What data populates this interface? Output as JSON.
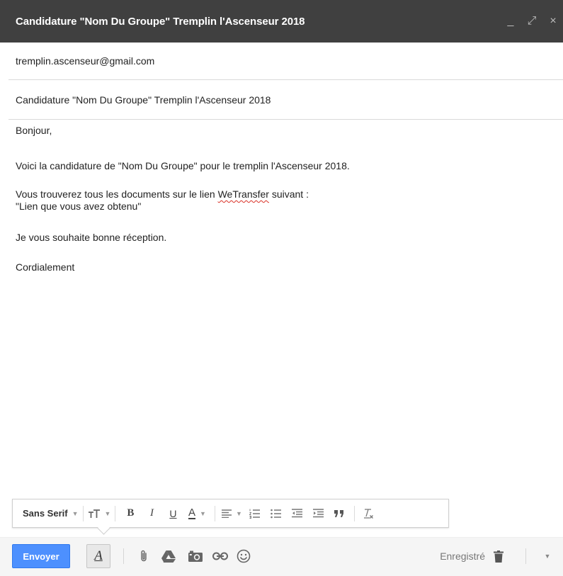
{
  "window": {
    "title": "Candidature \"Nom Du Groupe\" Tremplin l'Ascenseur 2018",
    "controls": {
      "minimize": "_",
      "expand": "⤢",
      "close": "×"
    }
  },
  "compose": {
    "to": "tremplin.ascenseur@gmail.com",
    "subject": "Candidature \"Nom Du Groupe\" Tremplin l'Ascenseur 2018",
    "body": {
      "greeting": "Bonjour,",
      "intro": "Voici la candidature de \"Nom Du Groupe\" pour le tremplin l'Ascenseur 2018.",
      "docs_before": "Vous trouverez tous les documents sur le lien ",
      "docs_link_word": "WeTransfer",
      "docs_after": " suivant :",
      "docs_line2": "\"Lien que vous avez obtenu\"",
      "reception": "Je vous souhaite bonne réception.",
      "closing": "Cordialement"
    }
  },
  "format_toolbar": {
    "font": "Sans Serif",
    "bold_label": "B",
    "italic_label": "I",
    "underline_label": "U",
    "text_color_label": "A",
    "icons": [
      "text-size-icon",
      "align-icon",
      "numbered-list-icon",
      "bulleted-list-icon",
      "indent-less-icon",
      "indent-more-icon",
      "quote-icon",
      "remove-format-icon"
    ]
  },
  "action_bar": {
    "send_label": "Envoyer",
    "format_toggle_label": "A",
    "saved_label": "Enregistré",
    "icons": [
      "attach-icon",
      "drive-icon",
      "photo-icon",
      "link-icon",
      "emoji-icon",
      "trash-icon"
    ]
  },
  "colors": {
    "titlebar": "#404040",
    "send_button": "#4d90fe",
    "misspell_underline": "#d93025"
  }
}
